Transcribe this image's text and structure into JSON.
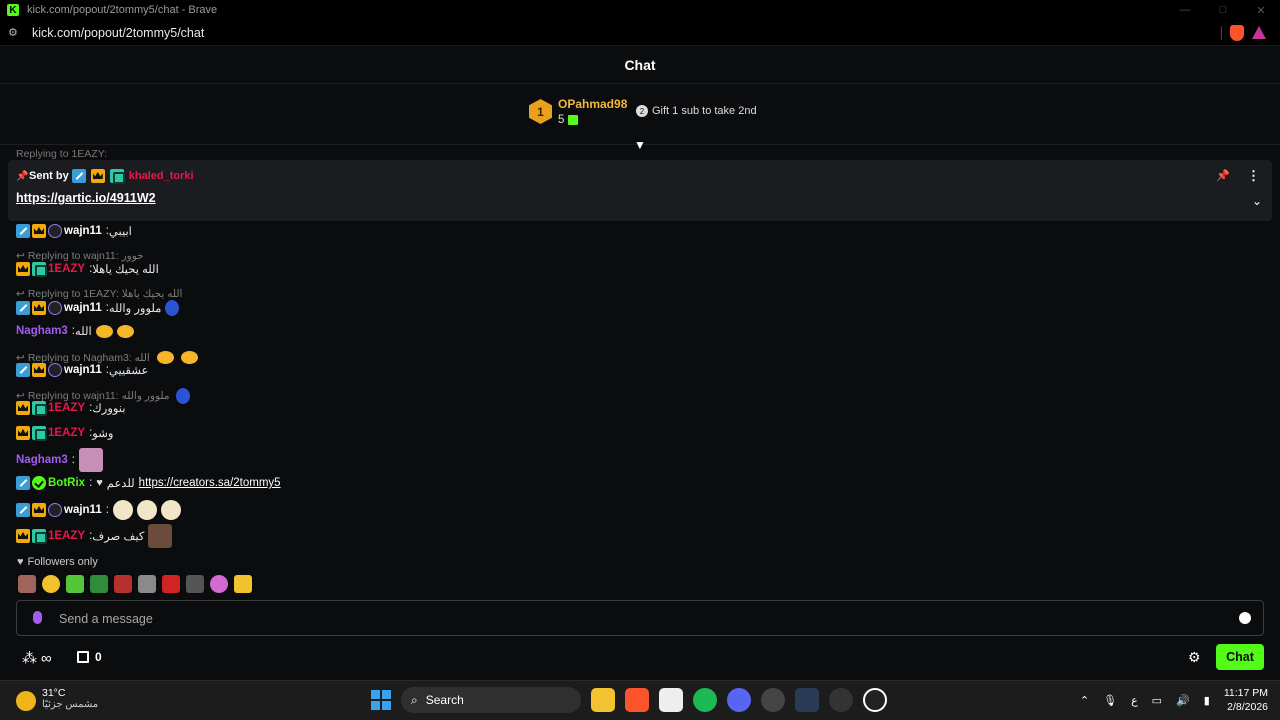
{
  "browser": {
    "window_title": "kick.com/popout/2tommy5/chat - Brave",
    "url": "kick.com/popout/2tommy5/chat"
  },
  "chat": {
    "title": "Chat"
  },
  "leaderboard": {
    "rank": "1",
    "username": "OPahmad98",
    "count": "5",
    "gift_text": "Gift 1 sub to take 2nd"
  },
  "pinned": {
    "sent_by_label": "Sent by",
    "sender": "khaled_torki",
    "link": "https://gartic.io/4911W2",
    "ghost_reply": "Replying to 1EAZY:"
  },
  "messages": [
    {
      "type": "msg",
      "badges": [
        "mod",
        "crown",
        "sub"
      ],
      "user": "wajn11",
      "user_class": "u-wajn",
      "text": "ابيبي"
    },
    {
      "type": "reply",
      "text": "Replying to wajn11: خوور"
    },
    {
      "type": "msg",
      "badges": [
        "crown",
        "og"
      ],
      "user": "1EAZY",
      "user_class": "u-eazy",
      "text": "الله يحيك ياهلا"
    },
    {
      "type": "reply",
      "text": "Replying to 1EAZY: الله يحيك ياهلا"
    },
    {
      "type": "msg",
      "badges": [
        "mod",
        "crown",
        "sub"
      ],
      "user": "wajn11",
      "user_class": "u-wajn",
      "text": "ملوور والله"
    },
    {
      "type": "msg",
      "badges": [],
      "user": "Nagham3",
      "user_class": "u-nagham",
      "text": "الله"
    },
    {
      "type": "reply",
      "text": "Replying to Nagham3: الله"
    },
    {
      "type": "msg",
      "badges": [
        "mod",
        "crown",
        "sub"
      ],
      "user": "wajn11",
      "user_class": "u-wajn",
      "text": "عشقييي"
    },
    {
      "type": "reply",
      "text": "Replying to wajn11: ملوور والله"
    },
    {
      "type": "msg",
      "badges": [
        "crown",
        "og"
      ],
      "user": "1EAZY",
      "user_class": "u-eazy",
      "text": "بنوورك"
    },
    {
      "type": "msg",
      "badges": [
        "crown",
        "og"
      ],
      "user": "1EAZY",
      "user_class": "u-eazy",
      "text": "وشو"
    },
    {
      "type": "msg",
      "badges": [],
      "user": "Nagham3",
      "user_class": "u-nagham",
      "text": ""
    },
    {
      "type": "msg",
      "badges": [
        "mod",
        "ver"
      ],
      "user": "BotRix",
      "user_class": "u-botrix",
      "text": "للدعم",
      "link": "https://creators.sa/2tommy5"
    },
    {
      "type": "msg",
      "badges": [
        "mod",
        "crown",
        "sub"
      ],
      "user": "wajn11",
      "user_class": "u-wajn",
      "text": ""
    },
    {
      "type": "msg",
      "badges": [
        "crown",
        "og"
      ],
      "user": "1EAZY",
      "user_class": "u-eazy",
      "text": "كيف صرف"
    }
  ],
  "followers_only": "Followers only",
  "input": {
    "placeholder": "Send a message"
  },
  "footer": {
    "gift_count": "0",
    "chat_button": "Chat"
  },
  "taskbar": {
    "temp": "31°C",
    "condition": "مشمس جزئيًا",
    "search": "Search",
    "time": "11:17 PM",
    "date": "2/8/2026",
    "lang": "ع"
  },
  "colors": {
    "accent": "#53fc18",
    "moderator": "#3b9dd6",
    "crown": "#f2a90c",
    "og": "#2cc9a6"
  }
}
